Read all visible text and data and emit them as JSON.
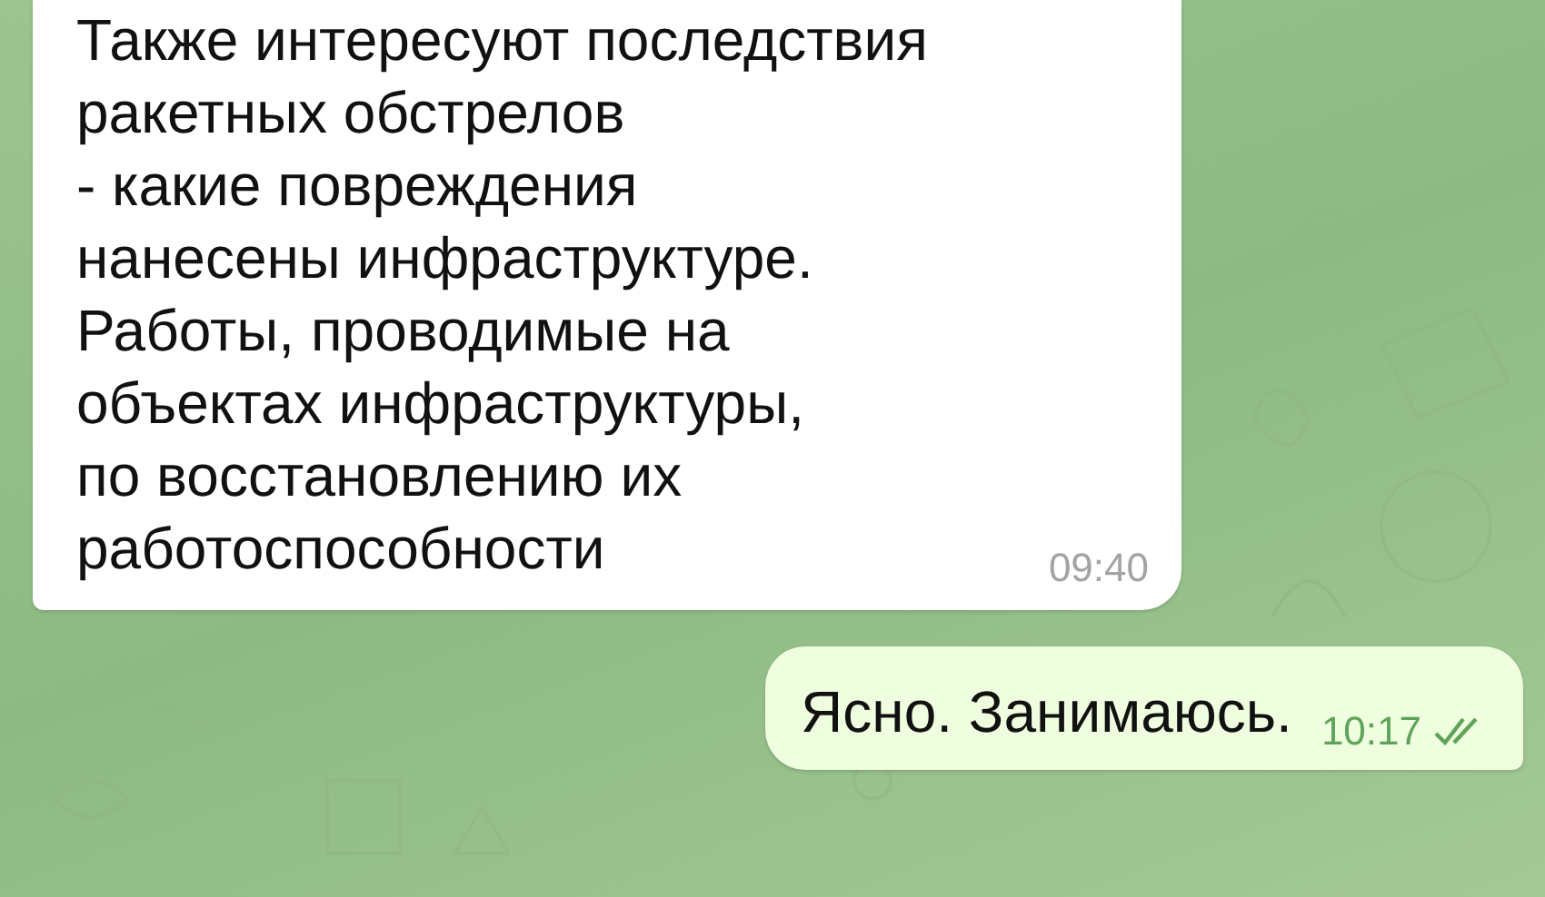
{
  "messages": [
    {
      "kind": "incoming",
      "text": "Также интересуют последствия\nракетных обстрелов\n- какие повреждения\nнанесены инфраструктуре.\nРаботы, проводимые на\nобъектах инфраструктуры,\nпо восстановлению их\nработоспособности",
      "time": "09:40"
    },
    {
      "kind": "outgoing",
      "text": "Ясно. Занимаюсь.",
      "time": "10:17",
      "read": true
    }
  ]
}
